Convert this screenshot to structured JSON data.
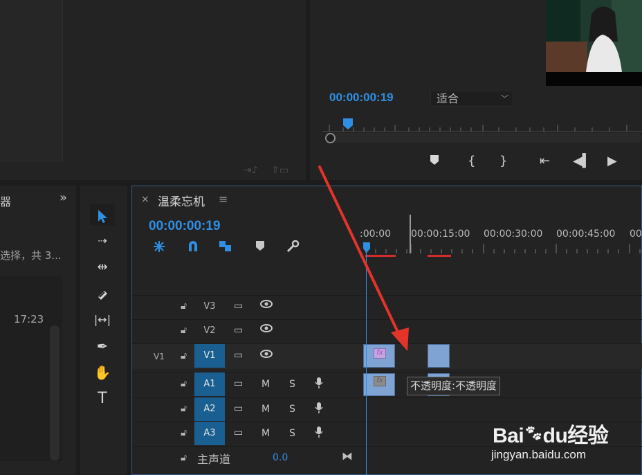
{
  "watermark": {
    "brand_pre": "Bai",
    "brand_mid": "du",
    "brand_post": "经验",
    "url": "jingyan.baidu.com"
  },
  "program_monitor": {
    "timecode": "00:00:00:19",
    "fit_value": "适合"
  },
  "project_panel": {
    "tab_label": "器",
    "more_icon": "»",
    "selection_info": "选择，共 3...",
    "clip_duration": "17:23"
  },
  "timeline": {
    "title": "温柔忘机",
    "timecode": "00:00:00:19",
    "ruler_labels": [
      ":00:00",
      "00:00:15:00",
      "00:00:30:00",
      "00:00:45:00",
      "00"
    ],
    "tracks": {
      "v3": "V3",
      "v2": "V2",
      "v1": "V1",
      "v1_source": "V1",
      "a1": "A1",
      "a2": "A2",
      "a3": "A3",
      "mute": "M",
      "solo": "S"
    },
    "master": {
      "label": "主声道",
      "value": "0.0"
    },
    "tooltip": "不透明度:不透明度",
    "fx_label": "fx"
  },
  "colors": {
    "accent": "#2e8fe3",
    "clip": "#7fa3d3",
    "track_on": "#1a5f91",
    "annotation_arrow": "#e3342a",
    "work_area": "#d52b2b"
  },
  "icons": [
    "selection-arrow-icon",
    "track-select-icon",
    "ripple-edit-icon",
    "razor-icon",
    "slip-icon",
    "pen-icon",
    "hand-icon",
    "type-icon",
    "lock-icon",
    "eye-icon",
    "film-icon",
    "mic-icon",
    "marker-icon",
    "wrench-icon",
    "snap-icon",
    "play-icon"
  ]
}
